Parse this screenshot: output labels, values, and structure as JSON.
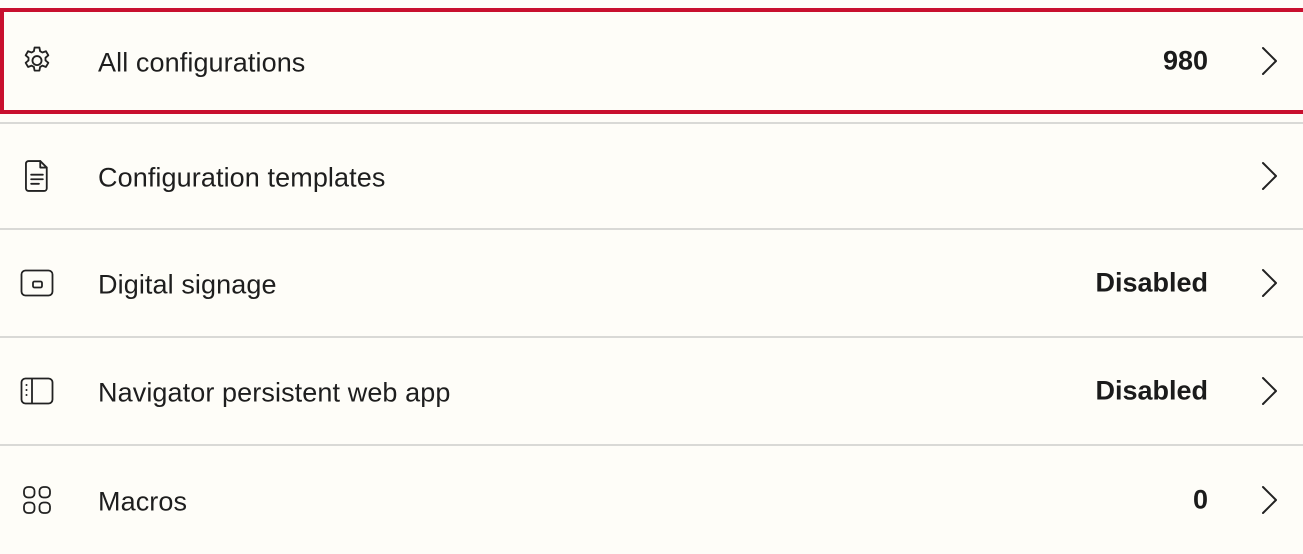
{
  "settings": {
    "items": [
      {
        "icon": "gear-icon",
        "label": "All configurations",
        "value": "980",
        "highlighted": true
      },
      {
        "icon": "document-icon",
        "label": "Configuration templates",
        "value": ""
      },
      {
        "icon": "display-icon",
        "label": "Digital signage",
        "value": "Disabled"
      },
      {
        "icon": "sidebar-panel-icon",
        "label": "Navigator persistent web app",
        "value": "Disabled"
      },
      {
        "icon": "grid-icon",
        "label": "Macros",
        "value": "0"
      }
    ]
  },
  "colors": {
    "background": "#fefdf8",
    "highlight_border": "#c8102e",
    "divider": "#d9d9d6",
    "text": "#1e1e1e"
  }
}
